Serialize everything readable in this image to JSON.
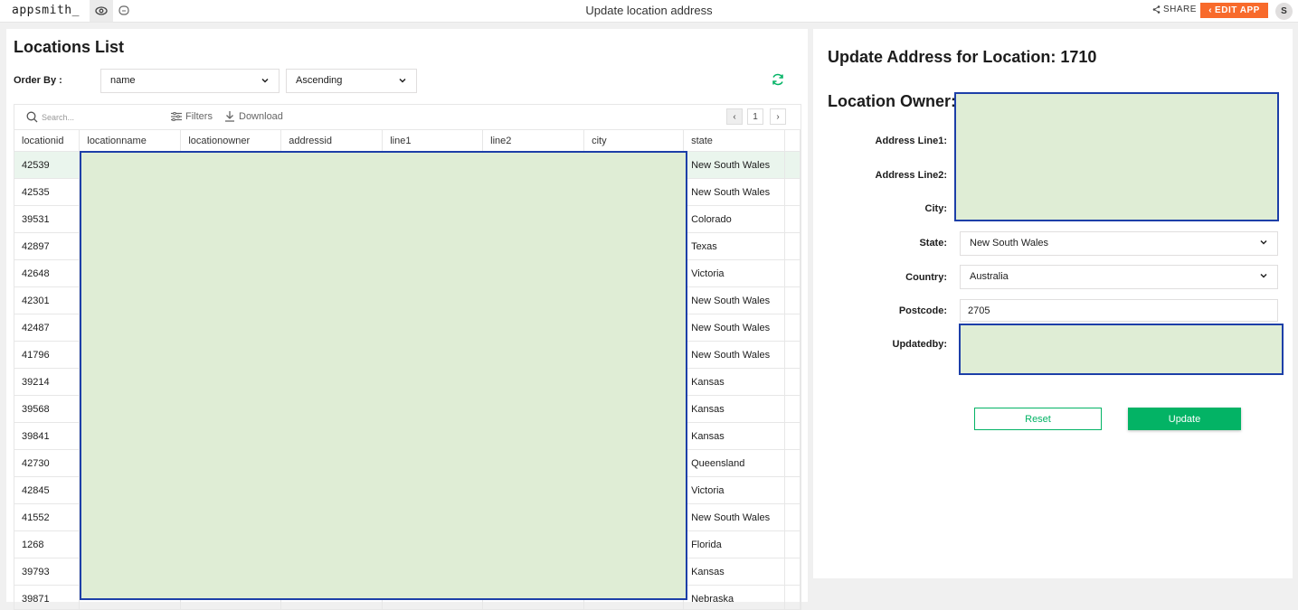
{
  "topbar": {
    "brand": "appsmith_",
    "title": "Update location address",
    "share_label": "SHARE",
    "edit_label": "EDIT APP",
    "avatar_initial": "S"
  },
  "list": {
    "title": "Locations List",
    "order_by_label": "Order By :",
    "order_field": "name",
    "order_direction": "Ascending",
    "search_placeholder": "Search...",
    "filters_label": "Filters",
    "download_label": "Download",
    "page_number": "1",
    "columns": [
      "locationid",
      "locationname",
      "locationowner",
      "addressid",
      "line1",
      "line2",
      "city",
      "state"
    ],
    "rows": [
      {
        "id": "42539",
        "state": "New South Wales"
      },
      {
        "id": "42535",
        "state": "New South Wales"
      },
      {
        "id": "39531",
        "state": "Colorado"
      },
      {
        "id": "42897",
        "state": "Texas"
      },
      {
        "id": "42648",
        "state": "Victoria"
      },
      {
        "id": "42301",
        "state": "New South Wales"
      },
      {
        "id": "42487",
        "state": "New South Wales"
      },
      {
        "id": "41796",
        "state": "New South Wales"
      },
      {
        "id": "39214",
        "state": "Kansas"
      },
      {
        "id": "39568",
        "state": "Kansas"
      },
      {
        "id": "39841",
        "state": "Kansas"
      },
      {
        "id": "42730",
        "state": "Queensland"
      },
      {
        "id": "42845",
        "state": "Victoria"
      },
      {
        "id": "41552",
        "state": "New South Wales"
      },
      {
        "id": "1268",
        "state": "Florida"
      },
      {
        "id": "39793",
        "state": "Kansas"
      },
      {
        "id": "39871",
        "state": "Nebraska"
      }
    ]
  },
  "form": {
    "title": "Update Address for Location: 1710",
    "owner_label": "Location Owner:",
    "line1_label": "Address Line1:",
    "line2_label": "Address Line2:",
    "city_label": "City:",
    "state_label": "State:",
    "state_value": "New South Wales",
    "country_label": "Country:",
    "country_value": "Australia",
    "postcode_label": "Postcode:",
    "postcode_value": "2705",
    "updatedby_label": "Updatedby:",
    "reset_label": "Reset",
    "update_label": "Update"
  },
  "colors": {
    "accent": "#03b365",
    "edit_app": "#f86a2b",
    "redaction_fill": "#dfedd5",
    "redaction_border": "#1d3fa8"
  }
}
